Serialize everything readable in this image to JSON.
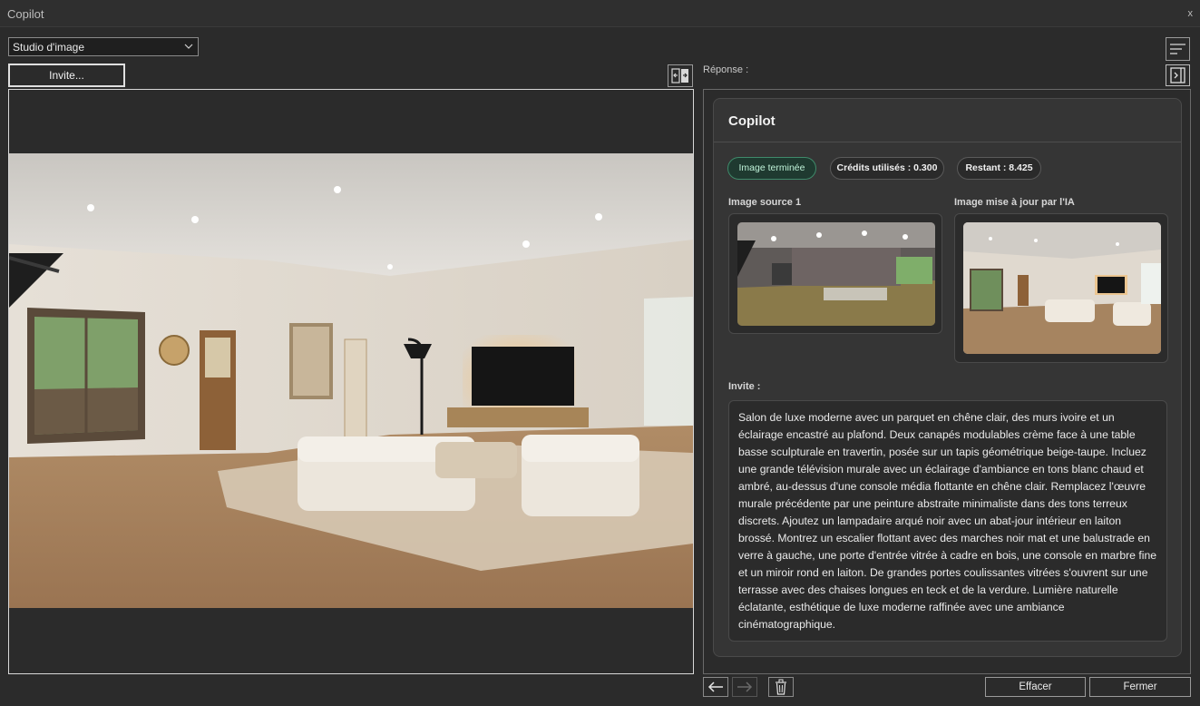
{
  "window": {
    "title": "Copilot",
    "close_label": "x"
  },
  "toolbar": {
    "mode_value": "Studio d'image",
    "prompt_button": "Invite..."
  },
  "response": {
    "label": "Réponse :",
    "card_title": "Copilot",
    "badges": {
      "status": "Image terminée",
      "credits_used": "Crédits utilisés : 0.300",
      "remaining": "Restant : 8.425"
    },
    "source_label": "Image source 1",
    "updated_label": "Image mise à jour par l'IA",
    "prompt_label": "Invite :",
    "prompt_text": "Salon de luxe moderne avec un parquet en chêne clair, des murs ivoire et un éclairage encastré au plafond. Deux canapés modulables crème face à une table basse sculpturale en travertin, posée sur un tapis géométrique beige-taupe. Incluez une grande télévision murale avec un éclairage d'ambiance en tons blanc chaud et ambré, au-dessus d'une console média flottante en chêne clair. Remplacez l'œuvre murale précédente par une peinture abstraite minimaliste dans des tons terreux discrets. Ajoutez un lampadaire arqué noir avec un abat-jour intérieur en laiton brossé. Montrez un escalier flottant avec des marches noir mat et une balustrade en verre à gauche, une porte d'entrée vitrée à cadre en bois, une console en marbre fine et un miroir rond en laiton. De grandes portes coulissantes vitrées s'ouvrent sur une terrasse avec des chaises longues en teck et de la verdure. Lumière naturelle éclatante, esthétique de luxe moderne raffinée avec une ambiance cinématographique."
  },
  "footer": {
    "clear_button": "Effacer",
    "close_button": "Fermer"
  },
  "icons": {
    "back": "arrow-left-icon",
    "forward": "arrow-right-icon",
    "delete": "trash-icon",
    "menu": "menu-lines-icon",
    "collapse": "panel-collapse-icon",
    "swap": "swap-view-icon",
    "dropdown": "chevron-down-icon"
  },
  "colors": {
    "background": "#2b2b2b",
    "success_badge": "#3f8a6a",
    "card": "#353535"
  }
}
